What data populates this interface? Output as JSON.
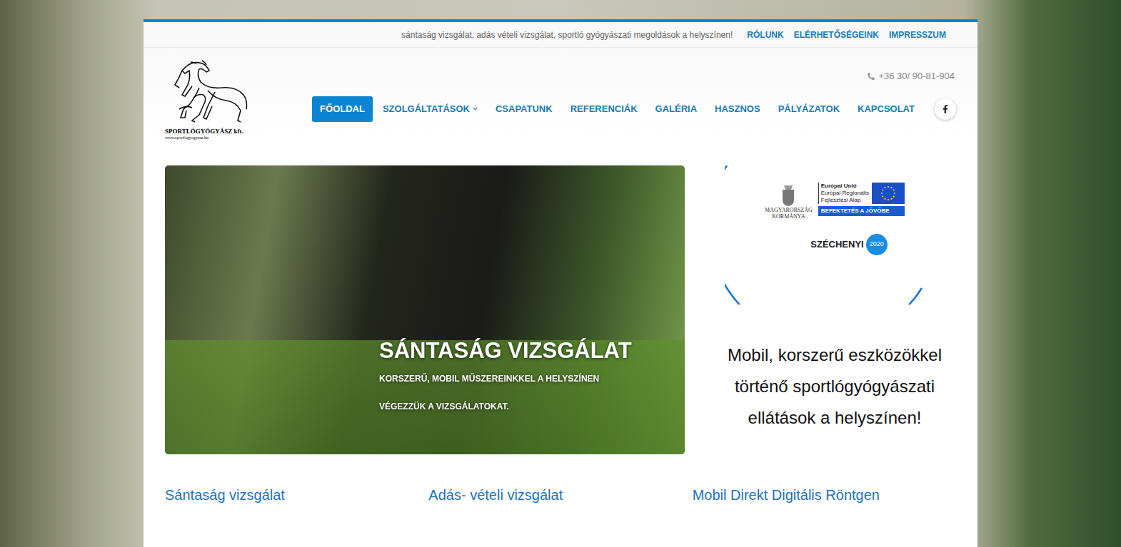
{
  "topbar": {
    "tagline": "sántaság vizsgálat, adás vételi vizsgálat, sportló gyógyászati megoldások a helyszínen!",
    "links": [
      "RÓLUNK",
      "ELÉRHETŐSÉGEINK",
      "IMPRESSZUM"
    ]
  },
  "logo": {
    "name": "SPORTLÓGYÓGYÁSZ kft.",
    "url": "www.sportlogyogyasz.hu"
  },
  "phone": "+36 30/ 90-81-904",
  "nav": [
    {
      "label": "FŐOLDAL",
      "selected": true,
      "dropdown": false
    },
    {
      "label": "SZOLGÁLTATÁSOK",
      "selected": false,
      "dropdown": true
    },
    {
      "label": "CSAPATUNK",
      "selected": false,
      "dropdown": false
    },
    {
      "label": "REFERENCIÁK",
      "selected": false,
      "dropdown": false
    },
    {
      "label": "GALÉRIA",
      "selected": false,
      "dropdown": false
    },
    {
      "label": "HASZNOS",
      "selected": false,
      "dropdown": false
    },
    {
      "label": "PÁLYÁZATOK",
      "selected": false,
      "dropdown": false
    },
    {
      "label": "KAPCSOLAT",
      "selected": false,
      "dropdown": false
    }
  ],
  "hero": {
    "title": "SÁNTASÁG VIZSGÁLAT",
    "lines": [
      "KORSZERŰ, MOBIL MŰSZEREINKKEL A HELYSZÍNEN",
      "VÉGEZZÜK A VIZSGÁLATOKAT."
    ]
  },
  "eu_badge": {
    "government": [
      "MAGYARORSZÁG",
      "KORMÁNYA"
    ],
    "eu_lines": [
      "Európai Unió",
      "Európai Regionális",
      "Fejlesztési Alap"
    ],
    "slogan": "BEFEKTETÉS A JÖVŐBE",
    "program": "SZÉCHENYI",
    "year": "2020"
  },
  "side_text": "Mobil, korszerű eszközökkel történő sportlógyógyászati ellátások a helyszínen!",
  "services": [
    "Sántaság vizsgálat",
    "Adás- vételi vizsgálat",
    "Mobil Direkt Digitális Röntgen"
  ]
}
